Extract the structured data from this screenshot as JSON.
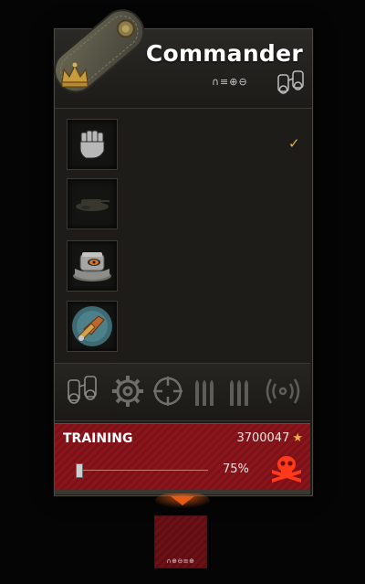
{
  "header": {
    "title": "Commander",
    "skill_icons": "∩≡⊕⊖"
  },
  "perks": {
    "check_mark": "✓",
    "items": [
      {
        "icon": "fist-icon"
      },
      {
        "icon": "tank-camo-icon"
      },
      {
        "icon": "ammo-box-icon"
      },
      {
        "icon": "repair-wrench-icon"
      }
    ]
  },
  "skills_bar": {
    "icons": [
      "binoculars-icon",
      "gear-icon",
      "crosshair-icon",
      "ammo-icon",
      "ammo-icon",
      "radio-icon"
    ]
  },
  "training": {
    "label": "TRAINING",
    "xp": "3700047",
    "xp_star": "★",
    "progress_percent": 75,
    "progress_text": "75%",
    "accent_color": "#8b151c"
  },
  "minicard": {
    "skill_icons": "∩⊕⊖≡⊕"
  }
}
